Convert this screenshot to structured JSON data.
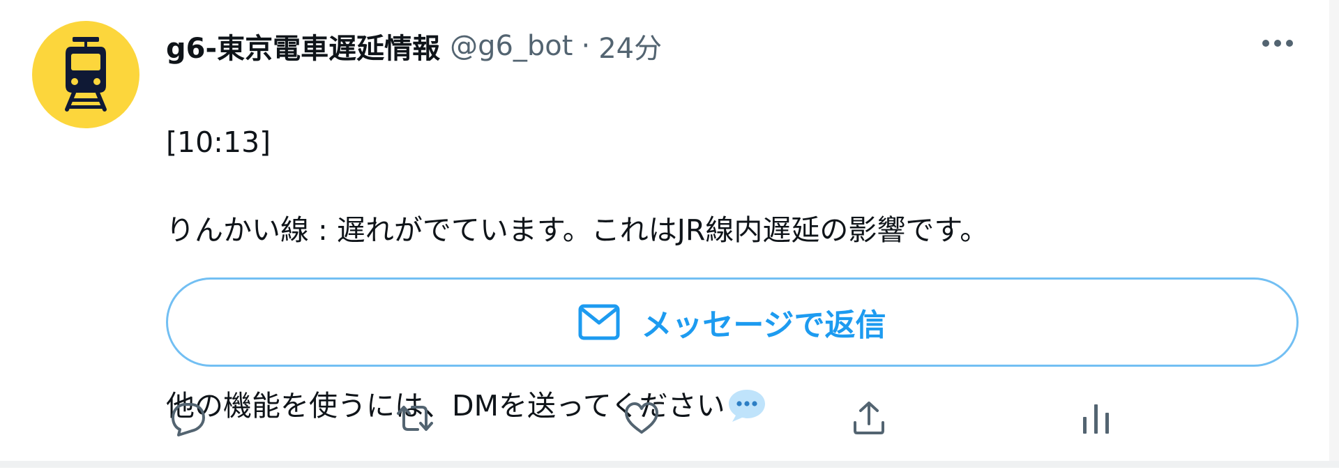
{
  "tweet": {
    "display_name": "g6-東京電車遅延情報",
    "handle": "@g6_bot",
    "separator": "·",
    "time": "24分",
    "lines": [
      "[10:13]",
      "りんかい線 : 遅れがでています。これはJR線内遅延の影響です。",
      "～～～",
      "他の機能を使うには、DMを送ってください"
    ]
  },
  "dm_button": {
    "label": "メッセージで返信"
  },
  "icons": {
    "avatar": "train-icon",
    "more": "more-icon",
    "emoji": "speech-balloon-icon",
    "mail": "mail-icon",
    "reply": "reply-icon",
    "retweet": "retweet-icon",
    "like": "like-icon",
    "share": "share-icon",
    "analytics": "analytics-icon"
  },
  "colors": {
    "accent": "#1d9bf0",
    "avatar_bg": "#fcd63c",
    "secondary_text": "#536471",
    "primary_text": "#0f1419",
    "button_border": "#72bff3",
    "icon_gray": "#536471"
  }
}
